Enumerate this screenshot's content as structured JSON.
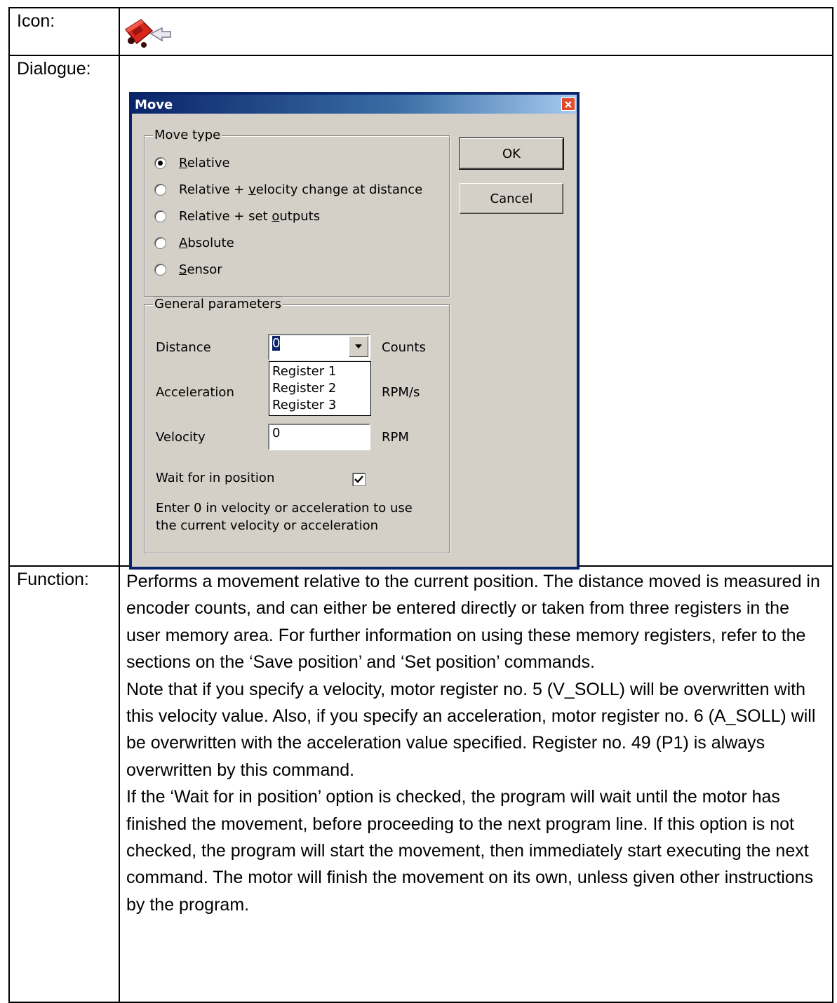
{
  "table": {
    "icon_label": "Icon:",
    "dialogue_label": "Dialogue:",
    "function_label": "Function:"
  },
  "icon": {
    "name": "move-command-icon",
    "color": "#d9261c"
  },
  "dialog": {
    "title": "Move",
    "move_type_group": "Move type",
    "options": [
      {
        "prefix": "",
        "accel": "R",
        "rest": "elative",
        "selected": true
      },
      {
        "prefix": "Relative + ",
        "accel": "v",
        "rest": "elocity change at distance",
        "selected": false
      },
      {
        "prefix": "Relative + set ",
        "accel": "o",
        "rest": "utputs",
        "selected": false
      },
      {
        "prefix": "",
        "accel": "A",
        "rest": "bsolute",
        "selected": false
      },
      {
        "prefix": "",
        "accel": "S",
        "rest": "ensor",
        "selected": false
      }
    ],
    "ok_label": "OK",
    "cancel_label": "Cancel",
    "params_group": "General parameters",
    "distance_label": "Distance",
    "distance_value": "0",
    "distance_unit": "Counts",
    "distance_options": [
      "Register 1",
      "Register 2",
      "Register 3"
    ],
    "acceleration_label": "Acceleration",
    "acceleration_unit": "RPM/s",
    "velocity_label": "Velocity",
    "velocity_value": "0",
    "velocity_unit": "RPM",
    "wait_label": "Wait for in position",
    "wait_checked": true,
    "note_line1": "Enter 0 in velocity or acceleration to use",
    "note_line2": "the current velocity or acceleration"
  },
  "function": {
    "paragraphs": [
      "Performs a movement relative to the current position. The distance moved is measured in encoder counts, and can either be entered directly or taken from three registers in the user memory area. For further information on using these memory registers, refer to the sections on the ‘Save position’ and ‘Set position’ commands.",
      "Note that if you specify a velocity, motor register no. 5 (V_SOLL) will be overwritten with this velocity value. Also, if you specify an acceleration, motor register no. 6 (A_SOLL) will be overwritten with the acceleration value specified. Register no. 49 (P1) is always overwritten by this command.",
      "If the ‘Wait for in position’ option is checked, the program will wait until the motor has finished the movement, before proceeding to the next program line. If this option is not checked, the program will start the movement, then immediately start executing the next command. The motor will finish the movement on its own, unless given other instructions by the program."
    ]
  }
}
